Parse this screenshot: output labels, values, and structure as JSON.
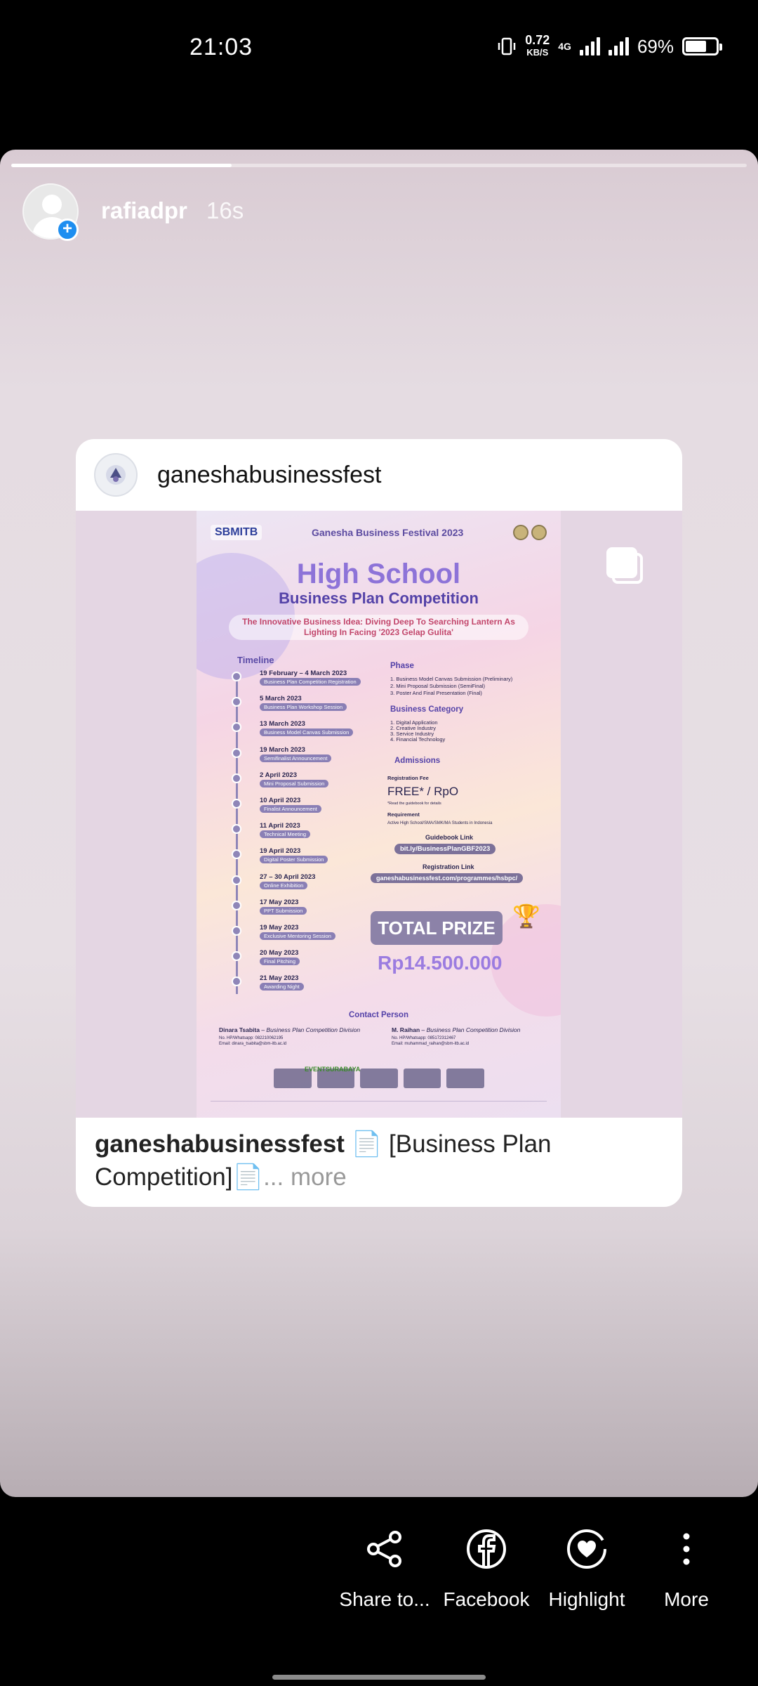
{
  "status_bar": {
    "time": "21:03",
    "net_speed_value": "0.72",
    "net_speed_unit": "KB/S",
    "network": "4G",
    "battery_pct": "69%",
    "battery_level": 0.69
  },
  "story": {
    "progress": 0.3,
    "username": "rafiadpr",
    "age": "16s",
    "shared_post": {
      "account": "ganeshabusinessfest",
      "caption_user": "ganeshabusinessfest",
      "caption_text": " 📄 [Business Plan Competition]📄",
      "caption_more": "... more",
      "poster": {
        "logo": "SBMITB",
        "festival": "Ganesha Business Festival 2023",
        "title": "High School",
        "subtitle": "Business Plan Competition",
        "theme": "The Innovative Business Idea: Diving Deep To Searching Lantern As Lighting In Facing '2023 Gelap Gulita'",
        "timeline_heading": "Timeline",
        "timeline": [
          {
            "date": "19 February – 4 March 2023",
            "event": "Business Plan Competition Registration"
          },
          {
            "date": "5 March 2023",
            "event": "Business Plan Workshop Session"
          },
          {
            "date": "13 March 2023",
            "event": "Business Model Canvas Submission"
          },
          {
            "date": "19 March 2023",
            "event": "Semifinalist Announcement"
          },
          {
            "date": "2 April 2023",
            "event": "Mini Proposal Submission"
          },
          {
            "date": "10 April 2023",
            "event": "Finalist Announcement"
          },
          {
            "date": "11 April 2023",
            "event": "Technical Meeting"
          },
          {
            "date": "19 April 2023",
            "event": "Digital Poster Submission"
          },
          {
            "date": "27 – 30 April 2023",
            "event": "Online Exhibition"
          },
          {
            "date": "17 May 2023",
            "event": "PPT Submission"
          },
          {
            "date": "19 May 2023",
            "event": "Exclusive Mentoring Session"
          },
          {
            "date": "20 May 2023",
            "event": "Final Pitching"
          },
          {
            "date": "21 May 2023",
            "event": "Awarding Night"
          }
        ],
        "phase_heading": "Phase",
        "phases": [
          "1. Business Model Canvas Submission (Preliminary)",
          "2. Mini Proposal Submission (SemiFinal)",
          "3. Poster And Final Presentation (Final)"
        ],
        "category_heading": "Business Category",
        "categories": [
          "1. Digital Application",
          "2. Creative Industry",
          "3. Service Industry",
          "4. Financial Technology"
        ],
        "admissions_heading": "Admissions",
        "fee_label": "Registration Fee",
        "fee_value": "FREE* / RpO",
        "fee_note": "*Read the guidebook for details",
        "requirement_label": "Requirement",
        "requirement_value": "Active High School/SMA/SMK/MA Students in Indonesia",
        "guidebook_label": "Guidebook Link",
        "guidebook_link": "bit.ly/BusinessPlanGBF2023",
        "registration_label": "Registration Link",
        "registration_link": "ganeshabusinessfest.com/programmes/hsbpc/",
        "prize_label": "TOTAL PRIZE",
        "prize_amount": "Rp14.500.000",
        "contact_heading": "Contact Person",
        "contact1_name": "Dinara Tsabita",
        "contact1_role": " – Business Plan Competition Division",
        "contact1_phone": "No. HP/Whatsapp: 082210062195",
        "contact1_email": "Email: dinara_tsabita@sbm-itb.ac.id",
        "contact2_name": "M. Raihan",
        "contact2_role": " – Business Plan Competition Division",
        "contact2_phone": "No. HP/Whatsapp: 085172312467",
        "contact2_email": "Email: muhammad_raihan@sbm-itb.ac.id",
        "sponsor_text": "EVENTSURABAYA"
      }
    }
  },
  "actions": [
    {
      "label": "Share to...",
      "icon": "share-icon"
    },
    {
      "label": "Facebook",
      "icon": "facebook-icon"
    },
    {
      "label": "Highlight",
      "icon": "highlight-icon"
    },
    {
      "label": "More",
      "icon": "more-vertical-icon"
    }
  ]
}
